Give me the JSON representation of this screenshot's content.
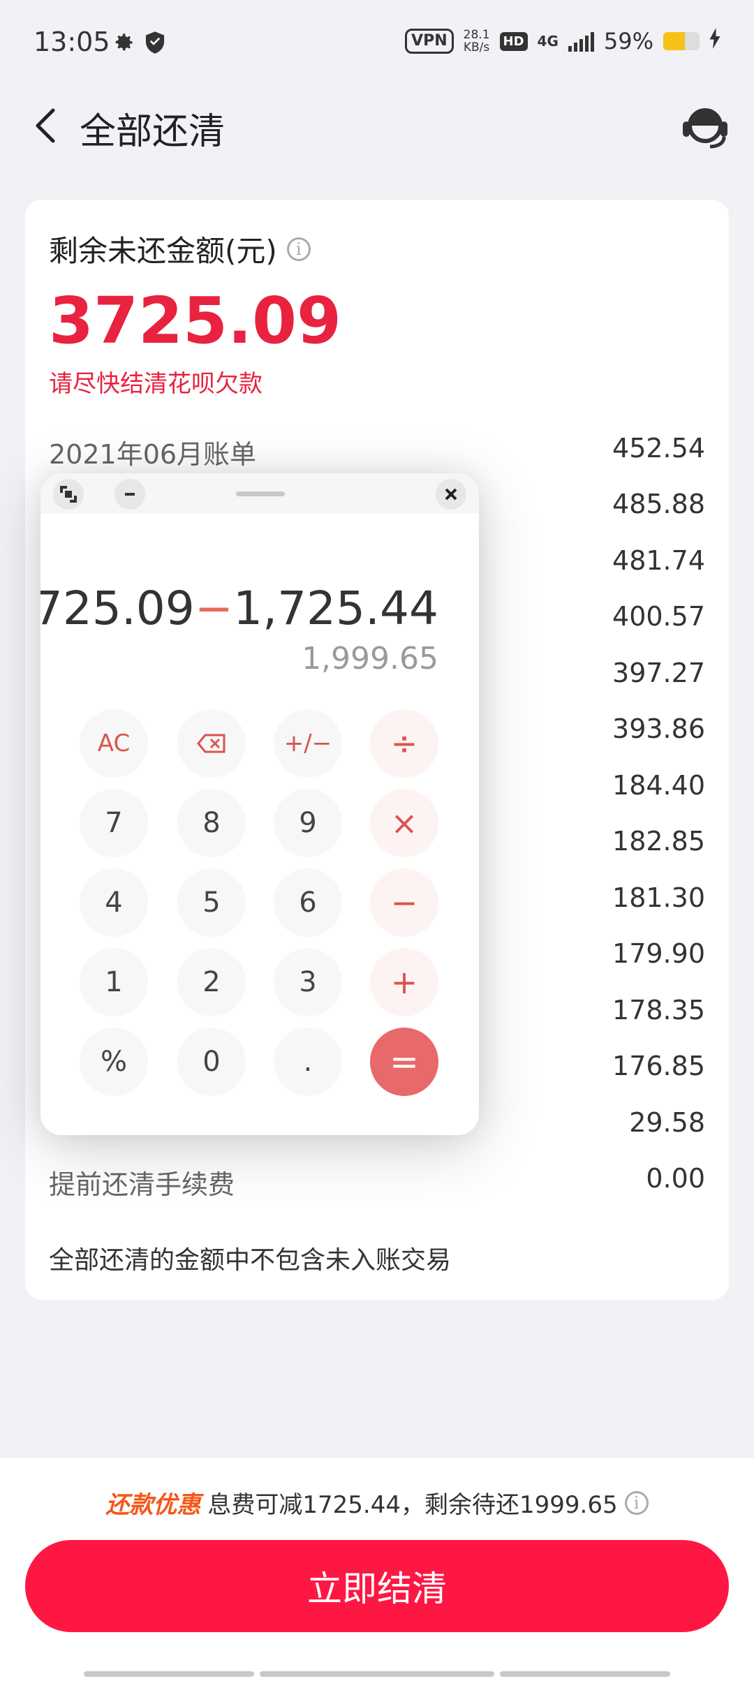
{
  "status_bar": {
    "time": "13:05",
    "vpn": "VPN",
    "speed_value": "28.1",
    "speed_unit": "KB/s",
    "hd": "HD",
    "network": "4G",
    "battery_percent": "59%",
    "battery_level": 0.59,
    "battery_color": "#f6c21a"
  },
  "header": {
    "title": "全部还清",
    "back_icon": "chevron-left-icon",
    "service_icon": "customer-service-icon"
  },
  "summary": {
    "label": "剩余未还金额(元)",
    "info_glyph": "i",
    "amount": "3725.09",
    "urge_text": "请尽快结清花呗欠款",
    "accent_color": "#e9223f"
  },
  "bills": [
    {
      "label": "2021年06月账单",
      "amount": "452.54"
    },
    {
      "label": "",
      "amount": "485.88"
    },
    {
      "label": "",
      "amount": "481.74"
    },
    {
      "label": "",
      "amount": "400.57"
    },
    {
      "label": "",
      "amount": "397.27"
    },
    {
      "label": "",
      "amount": "393.86"
    },
    {
      "label": "",
      "amount": "184.40"
    },
    {
      "label": "",
      "amount": "182.85"
    },
    {
      "label": "",
      "amount": "181.30"
    },
    {
      "label": "",
      "amount": "179.90"
    },
    {
      "label": "",
      "amount": "178.35"
    },
    {
      "label": "",
      "amount": "176.85"
    },
    {
      "label": "",
      "amount": "29.58"
    },
    {
      "label": "提前还清手续费",
      "amount": "0.00"
    }
  ],
  "note": "全部还清的金额中不包含未入账交易",
  "calculator": {
    "expression_left": ",725.09",
    "expression_op": "−",
    "expression_right": "1,725.44",
    "result": "1,999.65",
    "keys": {
      "ac": "AC",
      "backspace": "⌫",
      "sign": "+/−",
      "divide": "÷",
      "k7": "7",
      "k8": "8",
      "k9": "9",
      "multiply": "×",
      "k4": "4",
      "k5": "5",
      "k6": "6",
      "minus": "−",
      "k1": "1",
      "k2": "2",
      "k3": "3",
      "plus": "+",
      "percent": "%",
      "k0": "0",
      "dot": ".",
      "equals": "="
    }
  },
  "bottom": {
    "promo_tag": "还款优惠",
    "promo_text": "息费可减1725.44，剩余待还1999.65",
    "promo_info": "i",
    "pay_button": "立即结清",
    "button_color": "#ff1743"
  }
}
